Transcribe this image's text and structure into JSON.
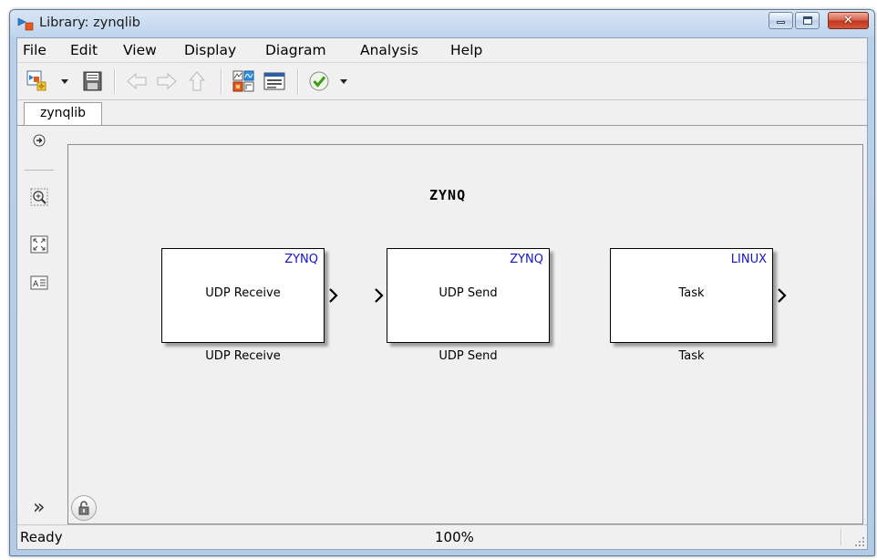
{
  "window": {
    "title": "Library: zynqlib",
    "close_glyph": "✕",
    "icons": [
      "simulink-model-icon",
      "minimize-icon",
      "maximize-icon",
      "close-icon"
    ]
  },
  "menu": {
    "items": [
      "File",
      "Edit",
      "View",
      "Display",
      "Diagram",
      "Analysis",
      "Help"
    ]
  },
  "toolbar": {
    "icons": [
      "new-model-icon",
      "save-icon",
      "back-arrow-icon",
      "forward-arrow-icon",
      "up-arrow-icon",
      "library-browser-icon",
      "model-explorer-icon",
      "model-advisor-check-icon"
    ]
  },
  "tabs": [
    {
      "label": "zynqlib"
    }
  ],
  "palette": {
    "icons": [
      "hide-show-explorer-icon",
      "zoom-icon",
      "fit-to-view-icon",
      "annotation-icon",
      "expand-palette-icon",
      "unlock-library-icon"
    ],
    "expand_glyph": "»"
  },
  "canvas": {
    "title": "ZYNQ",
    "blocks": [
      {
        "tag": "ZYNQ",
        "label": "UDP Receive",
        "name": "UDP Receive"
      },
      {
        "tag": "ZYNQ",
        "label": "UDP Send",
        "name": "UDP Send"
      },
      {
        "tag": "LINUX",
        "label": "Task",
        "name": "Task"
      }
    ]
  },
  "status": {
    "text": "Ready",
    "zoom": "100%"
  },
  "colors": {
    "block_tag": "#1414c8",
    "title_bar": "#c7daf0",
    "close_button": "#c1341c",
    "canvas_bg": "#f0f0f0"
  }
}
